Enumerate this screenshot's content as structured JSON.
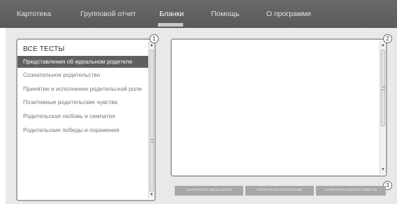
{
  "nav": {
    "items": [
      {
        "label": "Картотека"
      },
      {
        "label": "Групповой отчет"
      },
      {
        "label": "Бланки"
      },
      {
        "label": "Помощь"
      },
      {
        "label": "О программе"
      }
    ],
    "active_index": 2
  },
  "tests_list": {
    "header": "ВСЕ ТЕСТЫ",
    "items": [
      {
        "label": "Представления об идеальном родителе"
      },
      {
        "label": "Сознательное родительство"
      },
      {
        "label": "Принятие и исполнение родительской роли"
      },
      {
        "label": "Позитивные родительские чувства"
      },
      {
        "label": "Родительская любовь и симпатия"
      },
      {
        "label": "Родительские победы и поражения"
      }
    ],
    "selected_index": 0
  },
  "badges": {
    "list": "1",
    "preview": "2",
    "buttons": "3"
  },
  "actions": {
    "print_all": "НАПЕЧАТАТЬ ВЕСЬ БЛАНК",
    "print_questionnaire": "НАПЕЧАТАТЬ ВОПРОСНИК",
    "print_answers": "НАПЕЧАТАТЬ БЛАНК ОТВЕТОВ"
  },
  "colors": {
    "topbar": "#5f5f5f",
    "selected_row": "#5f5f5f",
    "button": "#a8a8a8",
    "panel_border": "#a8a8a8"
  }
}
